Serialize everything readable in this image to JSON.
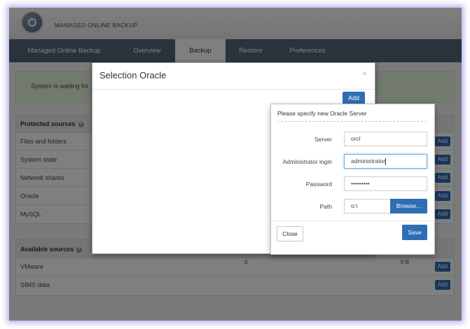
{
  "app": {
    "title": "MANAGED ONLINE BACKUP"
  },
  "nav": [
    {
      "label": "Managed Online Backup"
    },
    {
      "label": "Overview"
    },
    {
      "label": "Backup",
      "active": true
    },
    {
      "label": "Restore"
    },
    {
      "label": "Preferences"
    }
  ],
  "alert": {
    "text": "System is waiting for"
  },
  "protected": {
    "title": "Protected sources",
    "rows": [
      {
        "label": "Files and folders",
        "button": "Add"
      },
      {
        "label": "System state",
        "button": "Add"
      },
      {
        "label": "Network shares",
        "button": "Add"
      },
      {
        "label": "Oracle",
        "button": "Add"
      },
      {
        "label": "MySQL",
        "button": "Add"
      }
    ]
  },
  "available": {
    "title": "Available sources",
    "header_right": "0 B",
    "rows": [
      {
        "label": "VMware",
        "middle": "0",
        "right": "0 B",
        "button": "Add"
      },
      {
        "label": "SIMS data",
        "button": "Add"
      }
    ]
  },
  "modal": {
    "title": "Selection Oracle",
    "close_symbol": "×",
    "add_label": "Add"
  },
  "popover": {
    "header": "Please specify new Oracle Server",
    "server_label": "Server",
    "server_value": "orcl",
    "admin_label": "Administrator login",
    "admin_value": "administrator",
    "password_label": "Password",
    "password_value": "•••••••••",
    "path_label": "Path",
    "path_value": "o:\\",
    "browse_label": "Browse...",
    "close_label": "Close",
    "save_label": "Save"
  },
  "colors": {
    "accent": "#2f6db5",
    "navbar": "#54677b",
    "alert_bg": "#e5f2dc"
  }
}
